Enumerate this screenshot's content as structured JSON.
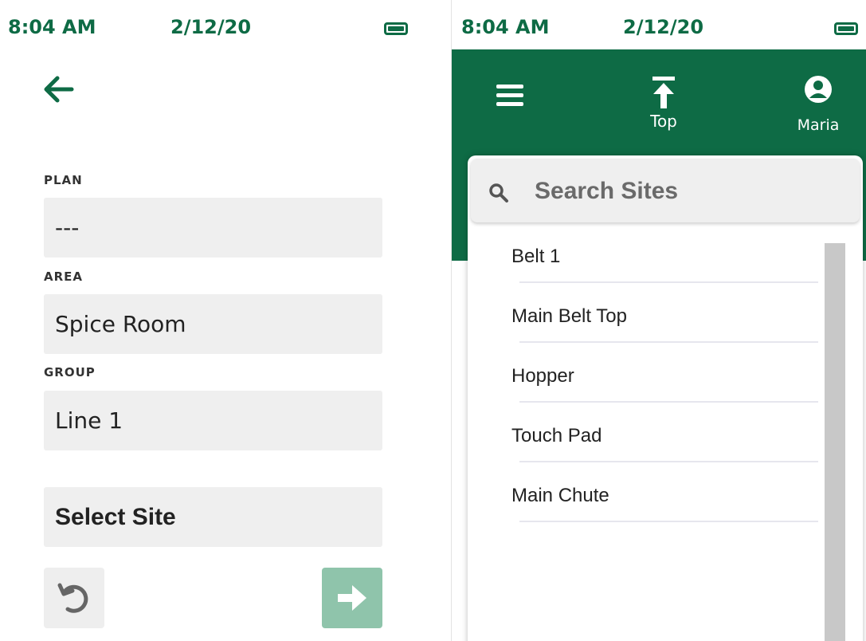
{
  "left_screen": {
    "status": {
      "time": "8:04 AM",
      "date": "2/12/20",
      "battery_icon": "battery-icon"
    },
    "fields": {
      "plan": {
        "label": "PLAN",
        "value": "---"
      },
      "area": {
        "label": "AREA",
        "value": "Spice Room"
      },
      "group": {
        "label": "GROUP",
        "value": "Line 1"
      }
    },
    "select_site_label": "Select Site",
    "icons": {
      "back": "arrow-left-icon",
      "reset": "undo-icon",
      "next": "arrow-right-icon"
    }
  },
  "right_screen": {
    "status": {
      "time": "8:04 AM",
      "date": "2/12/20",
      "battery_icon": "battery-icon"
    },
    "header": {
      "menu_icon": "hamburger-icon",
      "top_label": "Top",
      "user_label": "Maria"
    },
    "search": {
      "placeholder": "Search Sites"
    },
    "sites": [
      "Belt 1",
      "Main Belt Top",
      "Hopper",
      "Touch Pad",
      "Main Chute"
    ]
  },
  "colors": {
    "brand_green": "#0e6b45",
    "next_button": "#8fc4ab",
    "field_bg": "#efefef"
  }
}
